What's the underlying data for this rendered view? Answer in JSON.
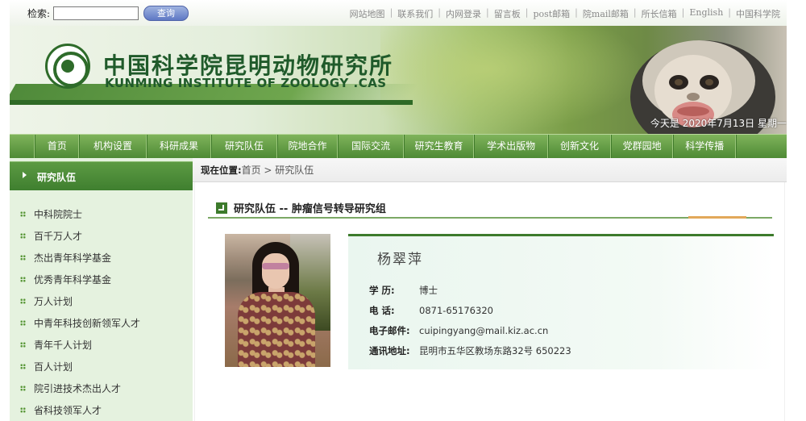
{
  "topbar": {
    "search_label": "检索:",
    "search_value": "",
    "search_button": "查询",
    "links": [
      "网站地图",
      "联系我们",
      "内网登录",
      "留言板",
      "post邮箱",
      "院mail邮箱",
      "所长信箱",
      "English",
      "中国科学院"
    ]
  },
  "banner": {
    "org_cn": "中国科学院昆明动物研究所",
    "org_en": "KUNMING INSTITUTE OF ZOOLOGY .CAS",
    "date_text": "今天是  2020年7月13日 星期一"
  },
  "nav": {
    "items": [
      "首页",
      "机构设置",
      "科研成果",
      "研究队伍",
      "院地合作",
      "国际交流",
      "研究生教育",
      "学术出版物",
      "创新文化",
      "党群园地",
      "科学传播"
    ]
  },
  "sidebar": {
    "title": "研究队伍",
    "items": [
      "中科院院士",
      "百千万人才",
      "杰出青年科学基金",
      "优秀青年科学基金",
      "万人计划",
      "中青年科技创新领军人才",
      "青年千人计划",
      "百人计划",
      "院引进技术杰出人才",
      "省科技领军人才"
    ]
  },
  "breadcrumb": {
    "lead": "现在位置:",
    "path": "首页 > 研究队伍"
  },
  "section": {
    "title": "研究队伍 -- 肿瘤信号转导研究组"
  },
  "profile": {
    "name": "杨翠萍",
    "rows": [
      {
        "label": "学    历:",
        "value": "博士"
      },
      {
        "label": "电    话:",
        "value": "0871-65176320"
      },
      {
        "label": "电子邮件:",
        "value": "cuipingyang@mail.kiz.ac.cn"
      },
      {
        "label": "通讯地址:",
        "value": "昆明市五华区教场东路32号    650223"
      }
    ]
  },
  "colors": {
    "primary_green": "#4e8a35",
    "dark_green": "#3d7b2c",
    "sidebar_bg": "#e5f2df",
    "accent_orange": "#e2a85a"
  }
}
